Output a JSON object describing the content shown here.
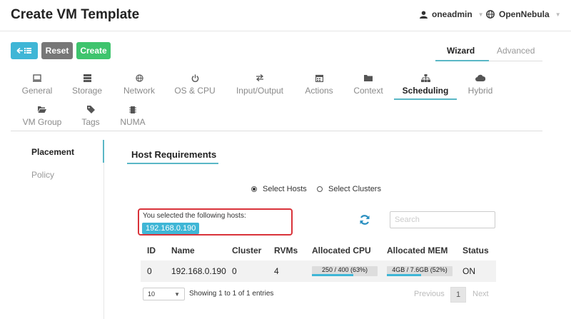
{
  "header": {
    "title": "Create VM Template",
    "user": "oneadmin",
    "zone": "OpenNebula"
  },
  "toolbar": {
    "back_icon": "back-list-icon",
    "reset_label": "Reset",
    "create_label": "Create",
    "mode_wizard": "Wizard",
    "mode_advanced": "Advanced",
    "active_mode": "Wizard"
  },
  "tabs": [
    {
      "label": "General",
      "icon": "monitor-icon"
    },
    {
      "label": "Storage",
      "icon": "storage-icon"
    },
    {
      "label": "Network",
      "icon": "globe-icon"
    },
    {
      "label": "OS & CPU",
      "icon": "power-icon"
    },
    {
      "label": "Input/Output",
      "icon": "exchange-icon"
    },
    {
      "label": "Actions",
      "icon": "calendar-icon"
    },
    {
      "label": "Context",
      "icon": "folder-icon"
    },
    {
      "label": "Scheduling",
      "icon": "sitemap-icon"
    },
    {
      "label": "Hybrid",
      "icon": "cloud-icon"
    },
    {
      "label": "VM Group",
      "icon": "folder-open-icon"
    },
    {
      "label": "Tags",
      "icon": "tag-icon"
    },
    {
      "label": "NUMA",
      "icon": "chip-icon"
    }
  ],
  "active_tab": "Scheduling",
  "sidenav": {
    "placement": "Placement",
    "policy": "Policy"
  },
  "section": {
    "title": "Host Requirements",
    "radio_hosts": "Select Hosts",
    "radio_clusters": "Select Clusters",
    "selected_radio": "Select Hosts",
    "selected_text": "You selected the following hosts:",
    "selected_host": "192.168.0.190",
    "search_placeholder": "Search"
  },
  "table": {
    "headers": [
      "ID",
      "Name",
      "Cluster",
      "RVMs",
      "Allocated CPU",
      "Allocated MEM",
      "Status"
    ],
    "rows": [
      {
        "id": "0",
        "name": "192.168.0.190",
        "cluster": "0",
        "rvms": "4",
        "cpu_label": "250 / 400 (63%)",
        "cpu_fraction": 0.63,
        "mem_label": "4GB / 7.6GB (52%)",
        "mem_fraction": 0.52,
        "status": "ON"
      }
    ]
  },
  "pagination": {
    "page_size": "10",
    "showing": "Showing 1 to 1 of 1 entries",
    "previous": "Previous",
    "current": "1",
    "next": "Next"
  },
  "colors": {
    "accent": "#3fb6d6",
    "reset": "#777777",
    "create": "#3ec46d",
    "highlight_border": "#d9333a"
  }
}
